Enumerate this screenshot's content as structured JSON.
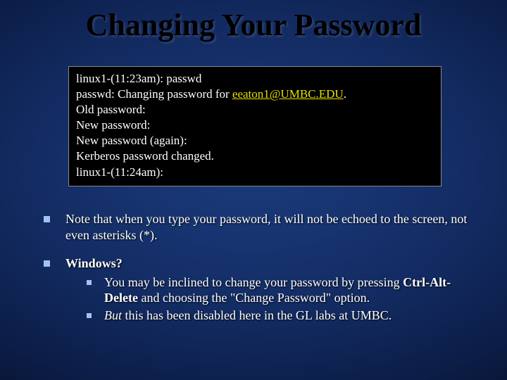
{
  "title": "Changing Your Password",
  "terminal": {
    "l1": "linux1-(11:23am): passwd",
    "l2a": "passwd: Changing password for ",
    "l2email": "eeaton1@UMBC.EDU",
    "l2b": ".",
    "l3": "Old password:",
    "l4": "New password:",
    "l5": "New password (again):",
    "l6": "Kerberos password changed.",
    "l7": "linux1-(11:24am):"
  },
  "bullets": {
    "b1": "Note that when you type your password, it will not be echoed to the screen, not even asterisks (*).",
    "b2_head": "Windows?",
    "b2_s1a": "You may be inclined to change your password by pressing ",
    "b2_s1b": "Ctrl-Alt-Delete",
    "b2_s1c": " and choosing the \"Change Password\" option.",
    "b2_s2a": "But",
    "b2_s2b": " this has been disabled here in the GL labs at UMBC."
  }
}
